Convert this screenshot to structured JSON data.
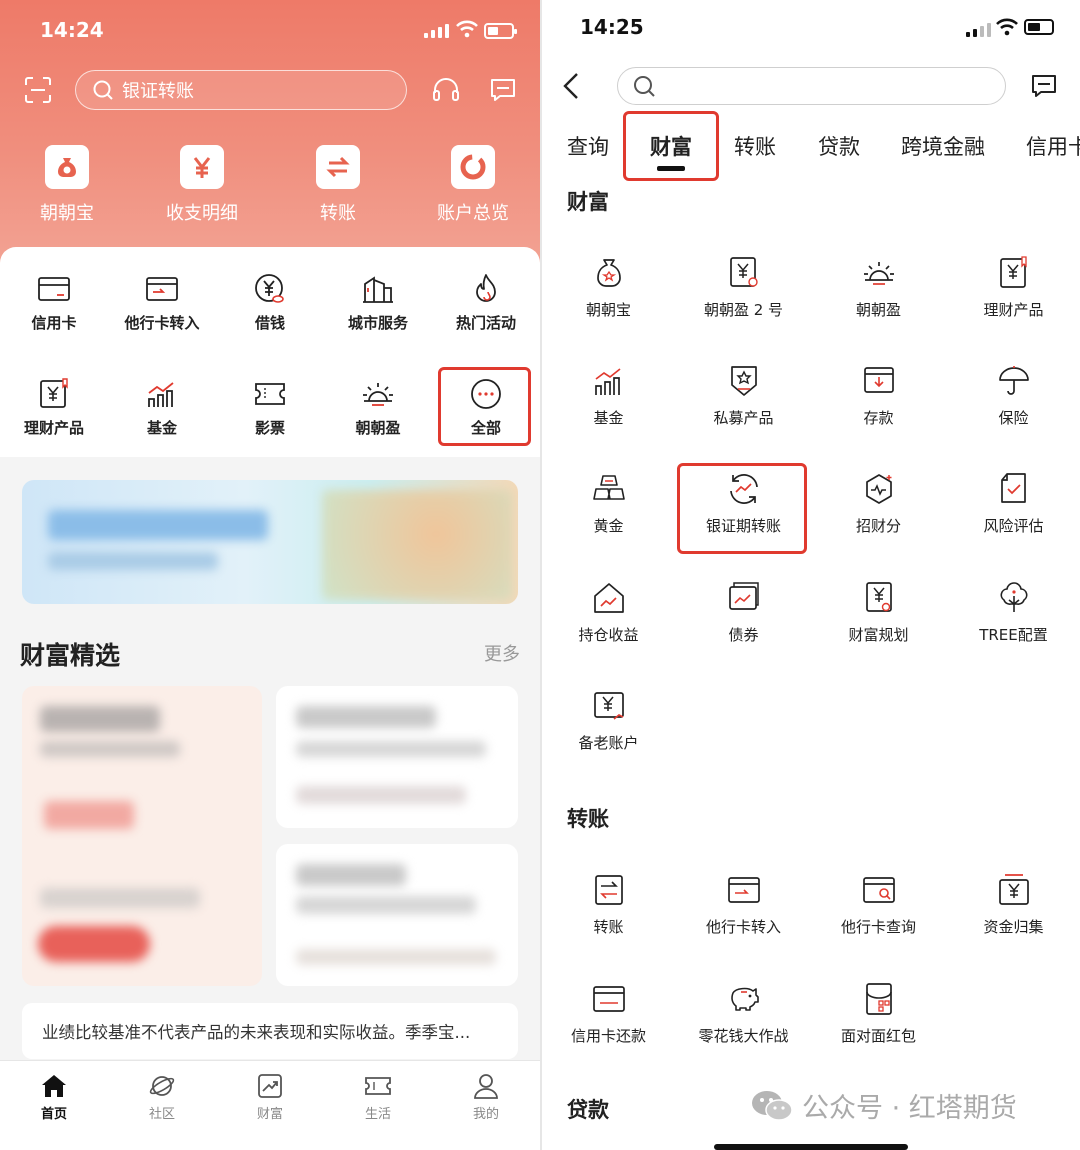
{
  "left": {
    "status": {
      "time": "14:24"
    },
    "search": {
      "placeholder": "银证转账"
    },
    "quick": [
      {
        "label": "朝朝宝",
        "icon": "money-bag-icon"
      },
      {
        "label": "收支明细",
        "icon": "yuan-icon"
      },
      {
        "label": "转账",
        "icon": "transfer-icon"
      },
      {
        "label": "账户总览",
        "icon": "donut-icon"
      }
    ],
    "grid_row1": [
      {
        "label": "信用卡",
        "icon": "credit-card-icon"
      },
      {
        "label": "他行卡转入",
        "icon": "card-transfer-in-icon"
      },
      {
        "label": "借钱",
        "icon": "borrow-icon"
      },
      {
        "label": "城市服务",
        "icon": "city-icon"
      },
      {
        "label": "热门活动",
        "icon": "flame-icon"
      }
    ],
    "grid_row2": [
      {
        "label": "理财产品",
        "icon": "wealth-product-icon"
      },
      {
        "label": "基金",
        "icon": "fund-chart-icon"
      },
      {
        "label": "影票",
        "icon": "ticket-icon"
      },
      {
        "label": "朝朝盈",
        "icon": "sunrise-icon"
      },
      {
        "label": "全部",
        "icon": "more-dots-icon"
      }
    ],
    "wealth": {
      "title": "财富精选",
      "more": "更多"
    },
    "disclaimer": "业绩比较基准不代表产品的未来表现和实际收益。季季宝...",
    "tabbar": [
      {
        "label": "首页",
        "icon": "home-icon",
        "active": true
      },
      {
        "label": "社区",
        "icon": "planet-icon",
        "active": false
      },
      {
        "label": "财富",
        "icon": "trend-icon",
        "active": false
      },
      {
        "label": "生活",
        "icon": "ticket-icon",
        "active": false
      },
      {
        "label": "我的",
        "icon": "user-icon",
        "active": false
      }
    ]
  },
  "right": {
    "status": {
      "time": "14:25"
    },
    "tabs": [
      "查询",
      "财富",
      "转账",
      "贷款",
      "跨境金融",
      "信用卡"
    ],
    "active_tab": "财富",
    "sections": {
      "wealth": {
        "title": "财富",
        "items": [
          {
            "label": "朝朝宝",
            "icon": "money-bag-icon"
          },
          {
            "label": "朝朝盈 2 号",
            "icon": "wealth-doc-icon"
          },
          {
            "label": "朝朝盈",
            "icon": "sunrise-icon"
          },
          {
            "label": "理财产品",
            "icon": "wealth-product-icon"
          },
          {
            "label": "基金",
            "icon": "fund-chart-icon"
          },
          {
            "label": "私募产品",
            "icon": "badge-star-icon"
          },
          {
            "label": "存款",
            "icon": "deposit-icon"
          },
          {
            "label": "保险",
            "icon": "umbrella-icon"
          },
          {
            "label": "黄金",
            "icon": "gold-bars-icon"
          },
          {
            "label": "银证期转账",
            "icon": "refresh-trend-icon"
          },
          {
            "label": "招财分",
            "icon": "hexagon-pulse-icon"
          },
          {
            "label": "风险评估",
            "icon": "risk-check-icon"
          },
          {
            "label": "持仓收益",
            "icon": "house-trend-icon"
          },
          {
            "label": "债券",
            "icon": "bond-icon"
          },
          {
            "label": "财富规划",
            "icon": "plan-doc-icon"
          },
          {
            "label": "TREE配置",
            "icon": "tree-icon"
          },
          {
            "label": "备老账户",
            "icon": "pension-icon"
          }
        ]
      },
      "transfer": {
        "title": "转账",
        "items": [
          {
            "label": "转账",
            "icon": "transfer-icon"
          },
          {
            "label": "他行卡转入",
            "icon": "card-transfer-in-icon"
          },
          {
            "label": "他行卡查询",
            "icon": "card-search-icon"
          },
          {
            "label": "资金归集",
            "icon": "fund-collect-icon"
          },
          {
            "label": "信用卡还款",
            "icon": "credit-repay-icon"
          },
          {
            "label": "零花钱大作战",
            "icon": "piggy-icon"
          },
          {
            "label": "面对面红包",
            "icon": "qr-envelope-icon"
          }
        ]
      },
      "loan": {
        "title": "贷款"
      }
    },
    "watermark": "公众号 · 红塔期货"
  },
  "colors": {
    "brand": "#ee7a68",
    "highlight": "#e03a2f",
    "accent": "#d33a2f"
  }
}
